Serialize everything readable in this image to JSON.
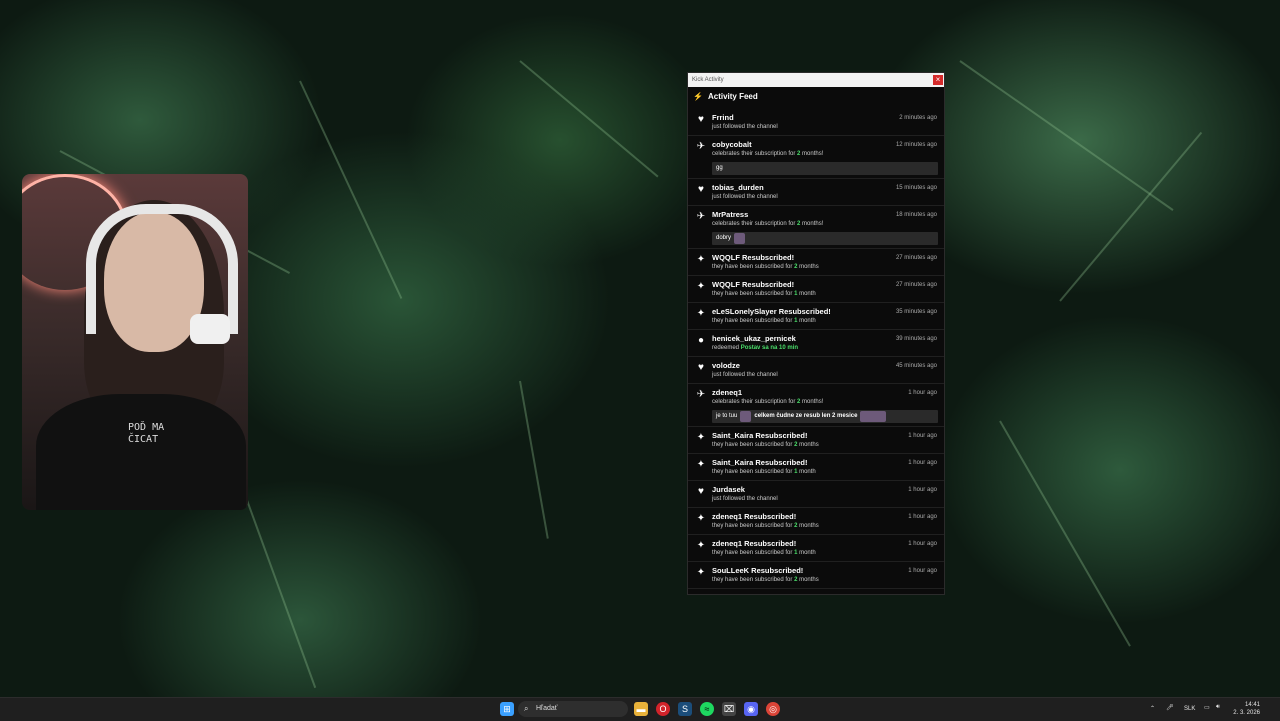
{
  "window": {
    "title": "Kick Activity",
    "close": "×",
    "feed_title": "Activity Feed",
    "events": [
      {
        "icon": "♥",
        "icon_name": "heart-icon",
        "user": "Frrind",
        "time": "2 minutes ago",
        "text": "just followed the channel"
      },
      {
        "icon": "✈",
        "icon_name": "gift-sub-icon",
        "user": "cobycobalt",
        "time": "12 minutes ago",
        "pre": "celebrates their subscription for ",
        "num": "2",
        "post": " months!",
        "message": "gg",
        "emotes": 0
      },
      {
        "icon": "♥",
        "icon_name": "heart-icon",
        "user": "tobias_durden",
        "time": "15 minutes ago",
        "text": "just followed the channel"
      },
      {
        "icon": "✈",
        "icon_name": "gift-sub-icon",
        "user": "MrPatress",
        "time": "18 minutes ago",
        "pre": "celebrates their subscription for ",
        "num": "2",
        "post": " months!",
        "message": "dobry",
        "emotes": 1
      },
      {
        "icon": "✦",
        "icon_name": "resub-icon",
        "user": "WQQLF Resubscribed!",
        "time": "27 minutes ago",
        "pre": "they have been subscribed for ",
        "num": "2",
        "post": " months"
      },
      {
        "icon": "✦",
        "icon_name": "resub-icon",
        "user": "WQQLF Resubscribed!",
        "time": "27 minutes ago",
        "pre": "they have been subscribed for ",
        "num": "1",
        "post": " month"
      },
      {
        "icon": "✦",
        "icon_name": "resub-icon",
        "user": "eLeSLonelySlayer Resubscribed!",
        "time": "35 minutes ago",
        "pre": "they have been subscribed for ",
        "num": "1",
        "post": " month"
      },
      {
        "icon": "●",
        "icon_name": "redeem-icon",
        "user": "henicek_ukaz_pernicek",
        "time": "39 minutes ago",
        "pre": "redeemed ",
        "num": "Postav sa na 10 min",
        "post": ""
      },
      {
        "icon": "♥",
        "icon_name": "heart-icon",
        "user": "volodze",
        "time": "45 minutes ago",
        "text": "just followed the channel"
      },
      {
        "icon": "✈",
        "icon_name": "gift-sub-icon",
        "user": "zdeneq1",
        "time": "1 hour ago",
        "pre": "celebrates their subscription for ",
        "num": "2",
        "post": " months!",
        "message": "je to tuu",
        "message2": "celkem čudne ze resub len 2 mesice",
        "emotes": 2
      },
      {
        "icon": "✦",
        "icon_name": "resub-icon",
        "user": "Saint_Kaira Resubscribed!",
        "time": "1 hour ago",
        "pre": "they have been subscribed for ",
        "num": "2",
        "post": " months"
      },
      {
        "icon": "✦",
        "icon_name": "resub-icon",
        "user": "Saint_Kaira Resubscribed!",
        "time": "1 hour ago",
        "pre": "they have been subscribed for ",
        "num": "1",
        "post": " month"
      },
      {
        "icon": "♥",
        "icon_name": "heart-icon",
        "user": "Jurdasek",
        "time": "1 hour ago",
        "text": "just followed the channel"
      },
      {
        "icon": "✦",
        "icon_name": "resub-icon",
        "user": "zdeneq1 Resubscribed!",
        "time": "1 hour ago",
        "pre": "they have been subscribed for ",
        "num": "2",
        "post": " months"
      },
      {
        "icon": "✦",
        "icon_name": "resub-icon",
        "user": "zdeneq1 Resubscribed!",
        "time": "1 hour ago",
        "pre": "they have been subscribed for ",
        "num": "1",
        "post": " month"
      },
      {
        "icon": "✦",
        "icon_name": "resub-icon",
        "user": "SouLLeeK Resubscribed!",
        "time": "1 hour ago",
        "pre": "they have been subscribed for ",
        "num": "2",
        "post": " months"
      }
    ]
  },
  "webcam": {
    "shirt_text": "POĎ MA\nČICAT"
  },
  "taskbar": {
    "search_placeholder": "Hľadať",
    "language": "SLK",
    "time": "14:41",
    "date": "2. 3. 2026"
  }
}
